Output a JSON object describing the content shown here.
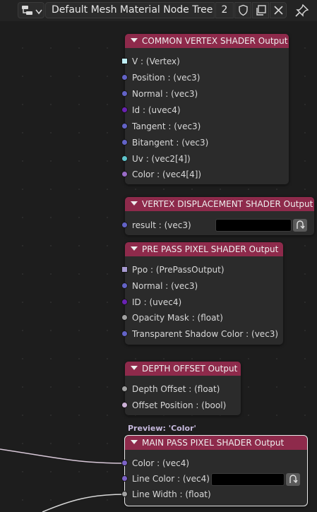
{
  "header": {
    "tree_name": "Default Mesh Material Node Tree",
    "users_count": "2",
    "icons": [
      "node-editor-icon",
      "chevron-down-icon",
      "fake-user-shield-icon",
      "duplicate-icon",
      "close-icon",
      "pin-icon"
    ]
  },
  "preview_label": "Preview: 'Color'",
  "nodes": {
    "common_vertex": {
      "title": "COMMON VERTEX SHADER Output",
      "sockets": [
        {
          "label": "V : (Vertex)",
          "color": "#bfeef5"
        },
        {
          "label": "Position : (vec3)",
          "color": "#6363c7"
        },
        {
          "label": "Normal : (vec3)",
          "color": "#6363c7"
        },
        {
          "label": "Id : (uvec4)",
          "color": "#6a22b3"
        },
        {
          "label": "Tangent : (vec3)",
          "color": "#6363c7"
        },
        {
          "label": "Bitangent : (vec3)",
          "color": "#6363c7"
        },
        {
          "label": "Uv : (vec2[4])",
          "color": "#5fc4cc"
        },
        {
          "label": "Color : (vec4[4])",
          "color": "#9a6cc8"
        }
      ]
    },
    "vertex_displacement": {
      "title": "VERTEX DISPLACEMENT SHADER Output",
      "sockets": [
        {
          "label": "result : (vec3)",
          "color": "#6363c7"
        }
      ]
    },
    "pre_pass": {
      "title": "PRE PASS PIXEL SHADER Output",
      "sockets": [
        {
          "label": "Ppo : (PrePassOutput)",
          "color": "#a79ad0"
        },
        {
          "label": "Normal : (vec3)",
          "color": "#6363c7"
        },
        {
          "label": "ID : (uvec4)",
          "color": "#6a22b3"
        },
        {
          "label": "Opacity Mask : (float)",
          "color": "#a1a1a1"
        },
        {
          "label": "Transparent Shadow Color : (vec3)",
          "color": "#6363c7"
        }
      ]
    },
    "depth_offset": {
      "title": "DEPTH OFFSET Output",
      "sockets": [
        {
          "label": "Depth Offset : (float)",
          "color": "#a1a1a1"
        },
        {
          "label": "Offset Position : (bool)",
          "color": "#ccb1d6"
        }
      ]
    },
    "main_pass": {
      "title": "MAIN PASS PIXEL SHADER Output",
      "sockets": [
        {
          "label": "Color : (vec4)",
          "color": "#7c62c7"
        },
        {
          "label": "Line Color : (vec4)",
          "color": "#7c62c7"
        },
        {
          "label": "Line Width : (float)",
          "color": "#a1a1a1"
        }
      ]
    }
  },
  "colors": {
    "node_header": "#8e2a4b",
    "node_body": "#2b2b2b",
    "canvas": "#1d1d1d"
  }
}
